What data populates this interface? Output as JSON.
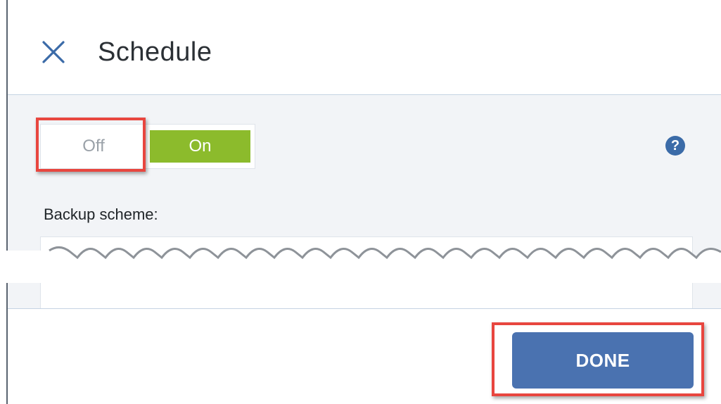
{
  "header": {
    "title": "Schedule",
    "close_icon": "close-icon"
  },
  "toggle": {
    "off_label": "Off",
    "on_label": "On",
    "selected": "On",
    "on_color": "#8cbb2c"
  },
  "help": {
    "icon": "help-icon",
    "glyph": "?"
  },
  "backup_scheme": {
    "label": "Backup scheme:"
  },
  "footer": {
    "done_label": "DONE",
    "button_color": "#4a72b0"
  },
  "annotations": {
    "highlight_color": "#e8463f"
  }
}
